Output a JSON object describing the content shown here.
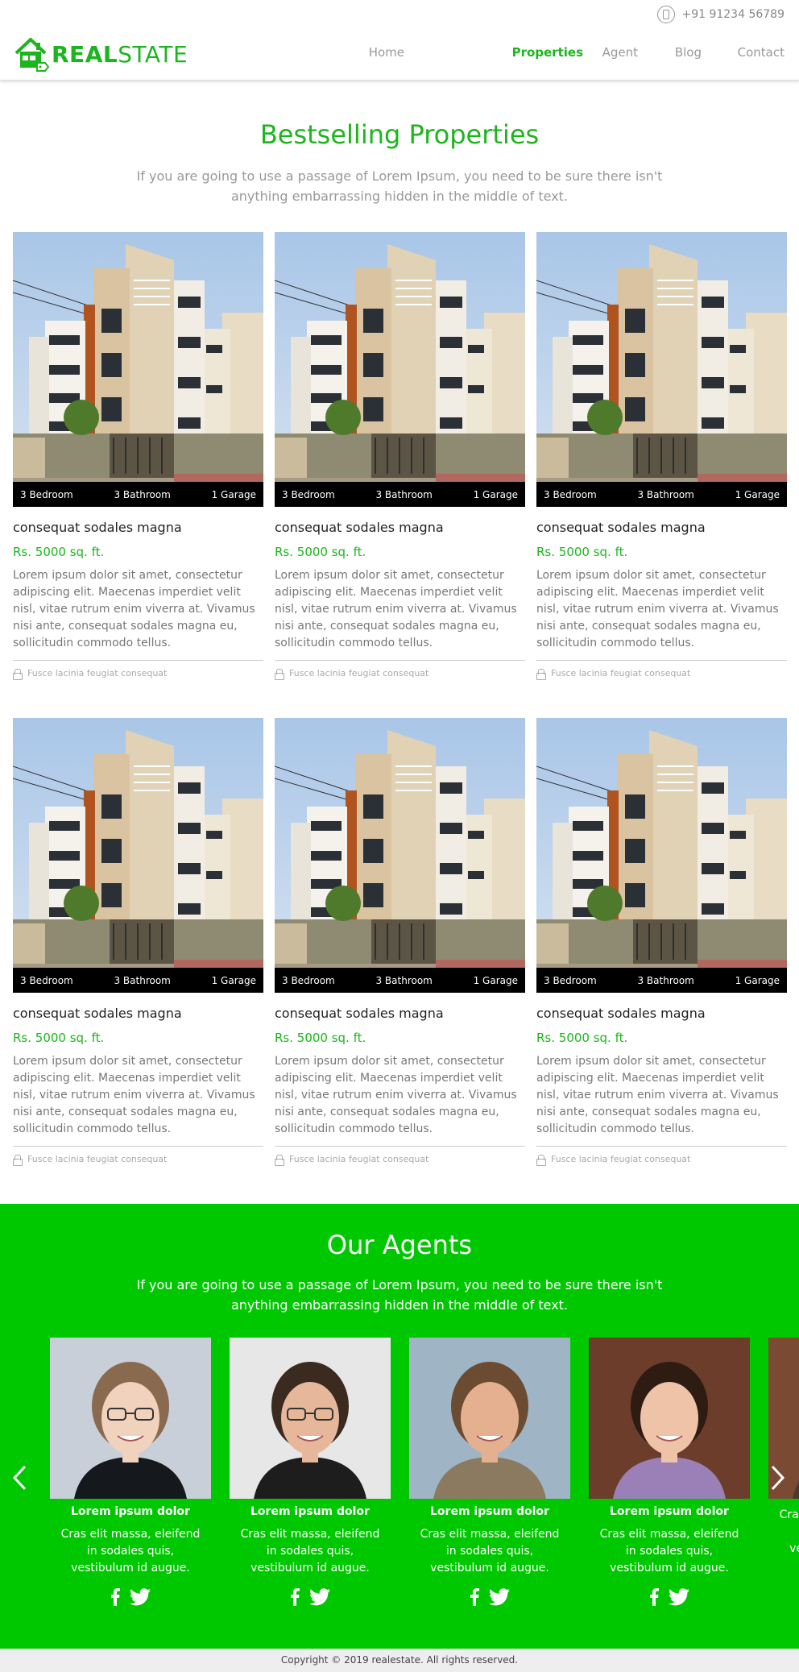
{
  "header": {
    "phone": "+91 91234 56789",
    "logo_bold": "REAL",
    "logo_light": "STATE",
    "nav": [
      "Home",
      "Properties",
      "Agent",
      "Blog",
      "Contact"
    ],
    "active_nav": "Properties",
    "accent_color": "#1db51d"
  },
  "bestselling": {
    "title": "Bestselling Properties",
    "subtitle": "If you are going to use a passage of Lorem Ipsum, you need to be sure there isn't anything embarrassing hidden in the middle of text.",
    "cards": [
      {
        "bedroom": "3 Bedroom",
        "bathroom": "3 Bathroom",
        "garage": "1 Garage",
        "title": "consequat sodales magna",
        "price": "Rs. 5000 sq. ft.",
        "desc": "Lorem ipsum dolor sit amet, consectetur adipiscing elit. Maecenas imperdiet velit nisl, vitae rutrum enim viverra at. Vivamus nisi ante, consequat sodales magna eu, sollicitudin commodo tellus.",
        "foot": "Fusce lacinia feugiat consequat"
      },
      {
        "bedroom": "3 Bedroom",
        "bathroom": "3 Bathroom",
        "garage": "1 Garage",
        "title": "consequat sodales magna",
        "price": "Rs. 5000 sq. ft.",
        "desc": "Lorem ipsum dolor sit amet, consectetur adipiscing elit. Maecenas imperdiet velit nisl, vitae rutrum enim viverra at. Vivamus nisi ante, consequat sodales magna eu, sollicitudin commodo tellus.",
        "foot": "Fusce lacinia feugiat consequat"
      },
      {
        "bedroom": "3 Bedroom",
        "bathroom": "3 Bathroom",
        "garage": "1 Garage",
        "title": "consequat sodales magna",
        "price": "Rs. 5000 sq. ft.",
        "desc": "Lorem ipsum dolor sit amet, consectetur adipiscing elit. Maecenas imperdiet velit nisl, vitae rutrum enim viverra at. Vivamus nisi ante, consequat sodales magna eu, sollicitudin commodo tellus.",
        "foot": "Fusce lacinia feugiat consequat"
      },
      {
        "bedroom": "3 Bedroom",
        "bathroom": "3 Bathroom",
        "garage": "1 Garage",
        "title": "consequat sodales magna",
        "price": "Rs. 5000 sq. ft.",
        "desc": "Lorem ipsum dolor sit amet, consectetur adipiscing elit. Maecenas imperdiet velit nisl, vitae rutrum enim viverra at. Vivamus nisi ante, consequat sodales magna eu, sollicitudin commodo tellus.",
        "foot": "Fusce lacinia feugiat consequat"
      },
      {
        "bedroom": "3 Bedroom",
        "bathroom": "3 Bathroom",
        "garage": "1 Garage",
        "title": "consequat sodales magna",
        "price": "Rs. 5000 sq. ft.",
        "desc": "Lorem ipsum dolor sit amet, consectetur adipiscing elit. Maecenas imperdiet velit nisl, vitae rutrum enim viverra at. Vivamus nisi ante, consequat sodales magna eu, sollicitudin commodo tellus.",
        "foot": "Fusce lacinia feugiat consequat"
      },
      {
        "bedroom": "3 Bedroom",
        "bathroom": "3 Bathroom",
        "garage": "1 Garage",
        "title": "consequat sodales magna",
        "price": "Rs. 5000 sq. ft.",
        "desc": "Lorem ipsum dolor sit amet, consectetur adipiscing elit. Maecenas imperdiet velit nisl, vitae rutrum enim viverra at. Vivamus nisi ante, consequat sodales magna eu, sollicitudin commodo tellus.",
        "foot": "Fusce lacinia feugiat consequat"
      }
    ]
  },
  "agents": {
    "title": "Our Agents",
    "subtitle": "If you are going to use a passage of Lorem Ipsum, you need to be sure there isn't anything embarrassing hidden in the middle of text.",
    "background_color": "#00c800",
    "items": [
      {
        "name": "Lorem ipsum dolor",
        "desc": "Cras elit massa, eleifend in sodales quis, vestibulum id augue."
      },
      {
        "name": "Lorem ipsum dolor",
        "desc": "Cras elit massa, eleifend in sodales quis, vestibulum id augue."
      },
      {
        "name": "Lorem ipsum dolor",
        "desc": "Cras elit massa, eleifend in sodales quis, vestibulum id augue."
      },
      {
        "name": "Lorem ipsum dolor",
        "desc": "Cras elit massa, eleifend in sodales quis, vestibulum id augue."
      },
      {
        "name": "",
        "desc": "Cras elit massa, eleifend in sodales quis, vestibulum id augue."
      }
    ]
  },
  "footer": {
    "copyright": "Copyright © 2019 realestate. All rights reserved."
  }
}
